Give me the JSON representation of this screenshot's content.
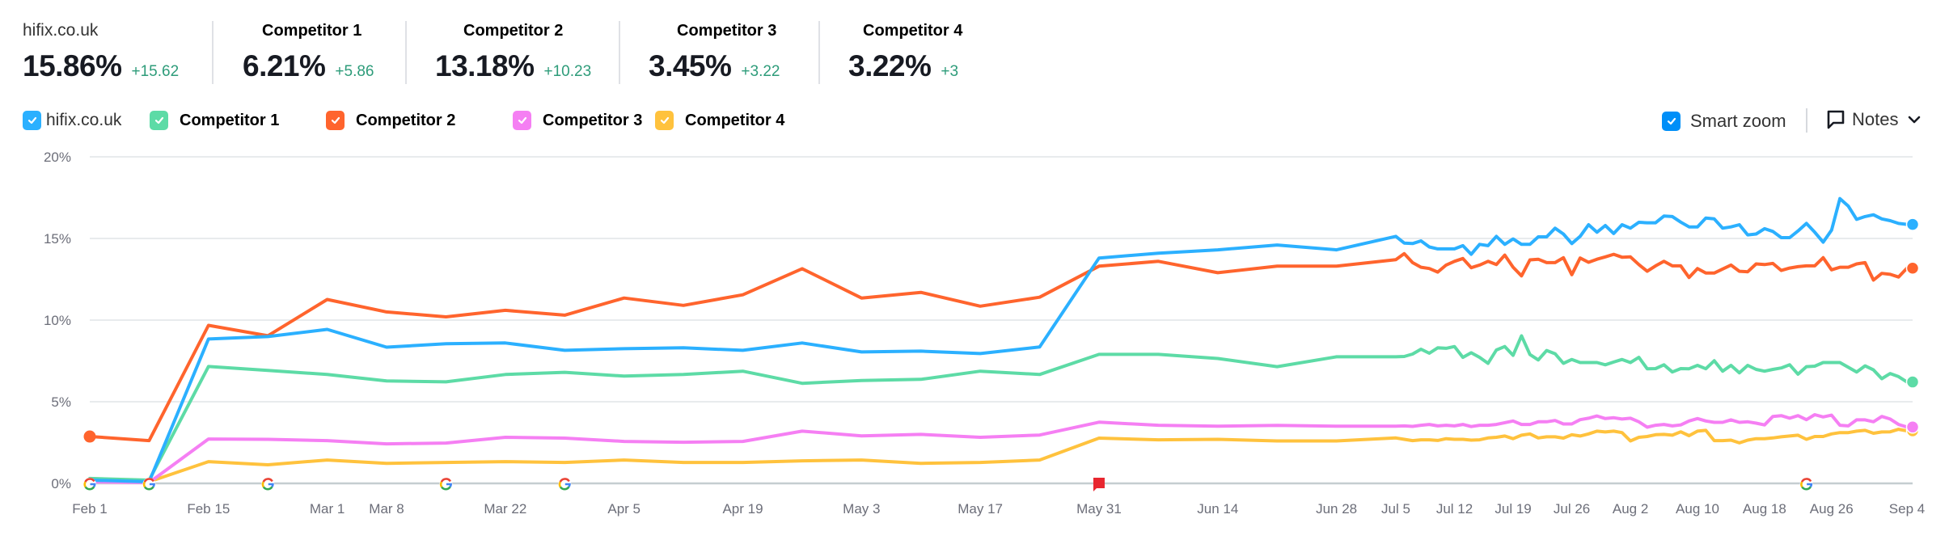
{
  "stats": [
    {
      "name": "hifix.co.uk",
      "value": "15.86%",
      "delta": "+15.62"
    },
    {
      "name": "Competitor 1",
      "value": "6.21%",
      "delta": "+5.86"
    },
    {
      "name": "Competitor 2",
      "value": "13.18%",
      "delta": "+10.23"
    },
    {
      "name": "Competitor 3",
      "value": "3.45%",
      "delta": "+3.22"
    },
    {
      "name": "Competitor 4",
      "value": "3.22%",
      "delta": "+3"
    }
  ],
  "legend": [
    {
      "label": "hifix.co.uk",
      "color": "#2bb0ff",
      "checked": true
    },
    {
      "label": "Competitor 1",
      "color": "#5ddba6",
      "checked": true
    },
    {
      "label": "Competitor 2",
      "color": "#ff642d",
      "checked": true
    },
    {
      "label": "Competitor 3",
      "color": "#f57ff3",
      "checked": true
    },
    {
      "label": "Competitor 4",
      "color": "#ffc23d",
      "checked": true
    }
  ],
  "toolbar": {
    "smart_zoom_label": "Smart zoom",
    "smart_zoom_checked": true,
    "notes_label": "Notes",
    "accent": "#008ff8"
  },
  "chart_data": {
    "type": "line",
    "title": "",
    "xlabel": "",
    "ylabel": "",
    "ylim": [
      0,
      20
    ],
    "yticks": [
      "0%",
      "5%",
      "10%",
      "15%",
      "20%"
    ],
    "ytick_values": [
      0,
      5,
      10,
      15,
      20
    ],
    "grid": true,
    "xticks": [
      "Feb 1",
      "Feb 15",
      "Mar 1",
      "Mar 8",
      "Mar 22",
      "Apr 5",
      "Apr 19",
      "May 3",
      "May 17",
      "May 31",
      "Jun 14",
      "Jun 28",
      "Jul 5",
      "Jul 12",
      "Jul 19",
      "Jul 26",
      "Aug 2",
      "Aug 10",
      "Aug 18",
      "Aug 26",
      "Sep 4"
    ],
    "weekly_x": [
      "Feb 1",
      "Feb 8",
      "Feb 15",
      "Feb 22",
      "Mar 1",
      "Mar 8",
      "Mar 15",
      "Mar 22",
      "Mar 29",
      "Apr 5",
      "Apr 12",
      "Apr 19",
      "Apr 26",
      "May 3",
      "May 10",
      "May 17",
      "May 24",
      "May 31",
      "Jun 7",
      "Jun 14",
      "Jun 21",
      "Jun 28"
    ],
    "daily_start": "Jul 5",
    "daily_end": "Sep 4",
    "series": [
      {
        "name": "hifix.co.uk",
        "color": "#2bb0ff",
        "weekly": [
          0.2,
          0.1,
          8.84,
          8.99,
          9.43,
          8.34,
          8.55,
          8.6,
          8.15,
          8.25,
          8.3,
          8.15,
          8.6,
          8.05,
          8.1,
          7.95,
          8.35,
          13.8,
          14.1,
          14.3,
          14.6,
          14.3
        ],
        "daily": [
          15.13,
          14.72,
          14.69,
          14.85,
          14.48,
          14.36,
          14.36,
          14.36,
          14.56,
          14.03,
          14.64,
          14.56,
          15.13,
          14.64,
          14.97,
          14.64,
          14.64,
          15.1,
          15.1,
          15.63,
          15.27,
          14.69,
          15.13,
          15.84,
          15.38,
          15.79,
          15.3,
          15.84,
          15.63,
          15.99,
          15.96,
          15.96,
          16.37,
          16.34,
          16.0,
          15.71,
          15.71,
          16.25,
          16.2,
          15.63,
          15.71,
          15.84,
          15.22,
          15.27,
          15.6,
          15.43,
          15.05,
          15.05,
          15.46,
          15.92,
          15.38,
          14.77,
          15.51,
          17.44,
          16.98,
          16.17,
          16.34,
          16.45,
          16.2,
          16.09,
          15.92,
          15.86
        ]
      },
      {
        "name": "Competitor 1",
        "color": "#5ddba6",
        "weekly": [
          0.3,
          0.2,
          7.16,
          6.92,
          6.67,
          6.27,
          6.22,
          6.67,
          6.8,
          6.57,
          6.67,
          6.87,
          6.13,
          6.3,
          6.37,
          6.87,
          6.67,
          7.9,
          7.9,
          7.65,
          7.15,
          7.75
        ],
        "daily": [
          7.75,
          7.77,
          7.92,
          8.22,
          7.97,
          8.3,
          8.27,
          8.38,
          7.72,
          8.0,
          7.72,
          7.35,
          8.17,
          8.38,
          7.84,
          9.04,
          7.89,
          7.56,
          8.14,
          7.94,
          7.35,
          7.59,
          7.4,
          7.4,
          7.4,
          7.26,
          7.43,
          7.59,
          7.4,
          7.72,
          7.02,
          7.03,
          7.26,
          6.82,
          7.03,
          7.02,
          7.23,
          7.02,
          7.51,
          6.87,
          7.23,
          6.77,
          7.23,
          6.98,
          6.87,
          6.98,
          7.07,
          7.26,
          6.69,
          7.15,
          7.18,
          7.4,
          7.4,
          7.4,
          7.11,
          6.82,
          7.2,
          6.95,
          6.41,
          6.73,
          6.54,
          6.21
        ]
      },
      {
        "name": "Competitor 2",
        "color": "#ff642d",
        "weekly": [
          2.87,
          2.62,
          9.68,
          9.04,
          11.26,
          10.5,
          10.2,
          10.6,
          10.3,
          11.35,
          10.9,
          11.55,
          13.15,
          11.35,
          11.7,
          10.85,
          11.4,
          13.3,
          13.6,
          12.9,
          13.3,
          13.3
        ],
        "daily": [
          13.7,
          14.07,
          13.52,
          13.24,
          13.16,
          12.94,
          13.37,
          13.6,
          13.77,
          13.21,
          13.37,
          13.6,
          13.4,
          13.98,
          13.24,
          12.71,
          13.69,
          13.73,
          13.52,
          13.52,
          13.82,
          12.78,
          13.8,
          13.54,
          13.73,
          13.87,
          14.03,
          13.85,
          13.87,
          13.4,
          12.99,
          13.32,
          13.6,
          13.32,
          13.32,
          12.61,
          13.16,
          12.88,
          12.88,
          13.13,
          13.37,
          12.99,
          12.96,
          13.44,
          13.4,
          13.47,
          13.04,
          13.19,
          13.27,
          13.32,
          13.32,
          13.82,
          13.08,
          13.24,
          13.24,
          13.44,
          13.52,
          12.45,
          12.86,
          12.8,
          12.64,
          13.18
        ]
      },
      {
        "name": "Competitor 3",
        "color": "#f57ff3",
        "weekly": [
          0.1,
          0.05,
          2.72,
          2.7,
          2.62,
          2.42,
          2.47,
          2.82,
          2.77,
          2.57,
          2.52,
          2.57,
          3.2,
          2.91,
          3.0,
          2.82,
          2.96,
          3.75,
          3.56,
          3.5,
          3.55,
          3.5
        ],
        "daily": [
          3.5,
          3.52,
          3.49,
          3.56,
          3.61,
          3.52,
          3.56,
          3.52,
          3.61,
          3.48,
          3.56,
          3.56,
          3.61,
          3.72,
          3.82,
          3.61,
          3.61,
          3.77,
          3.77,
          3.85,
          3.64,
          3.64,
          3.9,
          3.99,
          4.13,
          3.97,
          4.02,
          3.94,
          3.99,
          3.77,
          3.44,
          3.56,
          3.61,
          3.52,
          3.58,
          3.82,
          3.97,
          3.82,
          3.74,
          3.74,
          3.89,
          3.74,
          3.77,
          3.69,
          3.58,
          4.1,
          4.15,
          3.99,
          4.15,
          3.9,
          4.21,
          4.07,
          4.18,
          3.56,
          3.52,
          3.89,
          3.89,
          3.77,
          4.1,
          3.94,
          3.61,
          3.45
        ]
      },
      {
        "name": "Competitor 4",
        "color": "#ffc23d",
        "weekly": [
          0.15,
          0.1,
          1.33,
          1.14,
          1.43,
          1.23,
          1.28,
          1.33,
          1.28,
          1.43,
          1.28,
          1.28,
          1.38,
          1.43,
          1.23,
          1.28,
          1.43,
          2.77,
          2.67,
          2.7,
          2.6,
          2.6
        ],
        "daily": [
          2.78,
          2.7,
          2.62,
          2.67,
          2.67,
          2.63,
          2.74,
          2.7,
          2.7,
          2.65,
          2.67,
          2.78,
          2.82,
          2.9,
          2.74,
          2.95,
          3.03,
          2.78,
          2.85,
          2.85,
          2.77,
          2.98,
          2.9,
          3.03,
          3.2,
          3.15,
          3.2,
          3.11,
          2.6,
          2.82,
          2.87,
          2.98,
          3.0,
          2.95,
          3.16,
          2.92,
          3.2,
          3.25,
          2.62,
          2.62,
          2.65,
          2.48,
          2.65,
          2.74,
          2.74,
          2.78,
          2.85,
          2.9,
          2.95,
          2.7,
          2.87,
          2.87,
          3.03,
          3.11,
          3.11,
          3.2,
          3.25,
          3.07,
          3.15,
          3.16,
          3.31,
          3.22
        ]
      }
    ],
    "annotations": [
      {
        "type": "google-update",
        "date": "Feb 1"
      },
      {
        "type": "google-update",
        "date": "Feb 8"
      },
      {
        "type": "google-update",
        "date": "Feb 22"
      },
      {
        "type": "google-update",
        "date": "Mar 15"
      },
      {
        "type": "google-update",
        "date": "Mar 29"
      },
      {
        "type": "note-flag",
        "date": "May 31"
      },
      {
        "type": "google-update",
        "date": "Aug 23"
      }
    ]
  }
}
